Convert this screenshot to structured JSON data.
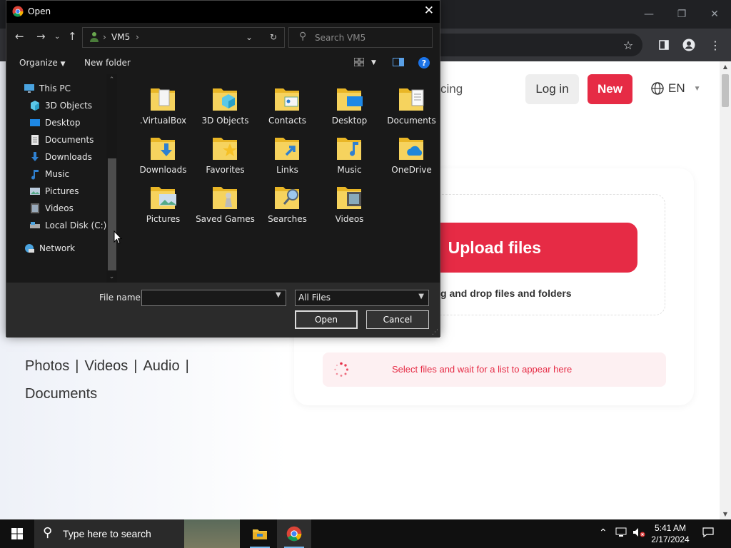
{
  "browser": {
    "window_controls": {
      "minimize": "—",
      "restore": "❐",
      "close": "✕"
    }
  },
  "webpage": {
    "nav_pricing": "cing",
    "login_button": "Log in",
    "new_button": "New",
    "language": "EN",
    "upload_button": "Upload files",
    "drag_text": "g and drop files and folders",
    "wait_text": "Select files and wait for a list to appear here",
    "media_links": [
      "Photos",
      "Videos",
      "Audio",
      "Documents"
    ],
    "media_sep": "|",
    "accent_color": "#e62b45"
  },
  "dialog": {
    "title": "Open",
    "breadcrumb": [
      "VM5"
    ],
    "search_placeholder": "Search VM5",
    "organize_label": "Organize",
    "new_folder_label": "New folder",
    "help_label": "?",
    "nav_items": [
      {
        "label": "This PC",
        "icon": "pc-icon"
      },
      {
        "label": "3D Objects",
        "icon": "3d-objects-icon"
      },
      {
        "label": "Desktop",
        "icon": "desktop-icon"
      },
      {
        "label": "Documents",
        "icon": "documents-icon"
      },
      {
        "label": "Downloads",
        "icon": "downloads-icon"
      },
      {
        "label": "Music",
        "icon": "music-icon"
      },
      {
        "label": "Pictures",
        "icon": "pictures-icon"
      },
      {
        "label": "Videos",
        "icon": "videos-icon"
      },
      {
        "label": "Local Disk (C:)",
        "icon": "disk-icon"
      },
      {
        "label": "Network",
        "icon": "network-icon"
      }
    ],
    "files": [
      {
        "name": ".VirtualBox",
        "badge": "doc"
      },
      {
        "name": "3D Objects",
        "badge": "cube"
      },
      {
        "name": "Contacts",
        "badge": "card"
      },
      {
        "name": "Desktop",
        "badge": "screen"
      },
      {
        "name": "Documents",
        "badge": "page"
      },
      {
        "name": "Downloads",
        "badge": "arrow"
      },
      {
        "name": "Favorites",
        "badge": "star"
      },
      {
        "name": "Links",
        "badge": "link"
      },
      {
        "name": "Music",
        "badge": "note"
      },
      {
        "name": "OneDrive",
        "badge": "cloud"
      },
      {
        "name": "Pictures",
        "badge": "photo"
      },
      {
        "name": "Saved Games",
        "badge": "chess"
      },
      {
        "name": "Searches",
        "badge": "lens"
      },
      {
        "name": "Videos",
        "badge": "film"
      }
    ],
    "file_name_label": "File name:",
    "file_name_value": "",
    "file_type": "All Files",
    "open_button": "Open",
    "cancel_button": "Cancel"
  },
  "taskbar": {
    "search_placeholder": "Type here to search",
    "time": "5:41 AM",
    "date": "2/17/2024"
  }
}
